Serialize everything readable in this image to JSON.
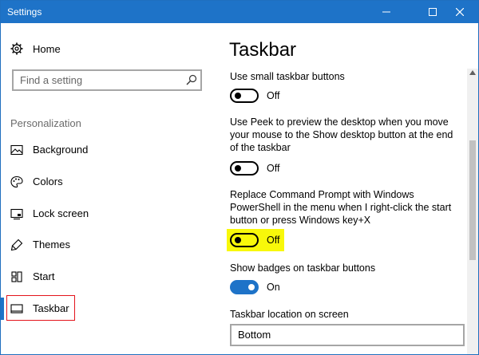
{
  "window": {
    "title": "Settings"
  },
  "sidebar": {
    "home_label": "Home",
    "search_placeholder": "Find a setting",
    "section_heading": "Personalization",
    "items": [
      {
        "label": "Background",
        "icon": "picture-icon"
      },
      {
        "label": "Colors",
        "icon": "palette-icon"
      },
      {
        "label": "Lock screen",
        "icon": "lock-screen-icon"
      },
      {
        "label": "Themes",
        "icon": "themes-icon"
      },
      {
        "label": "Start",
        "icon": "start-icon"
      },
      {
        "label": "Taskbar",
        "icon": "taskbar-icon",
        "selected": true
      }
    ]
  },
  "main": {
    "title": "Taskbar",
    "settings": [
      {
        "label": "Use small taskbar buttons",
        "state": "Off",
        "on": false
      },
      {
        "label": "Use Peek to preview the desktop when you move your mouse to the Show desktop button at the end of the taskbar",
        "state": "Off",
        "on": false
      },
      {
        "label": "Replace Command Prompt with Windows PowerShell in the menu when I right-click the start button or press Windows key+X",
        "state": "Off",
        "on": false,
        "highlighted": true
      },
      {
        "label": "Show badges on taskbar buttons",
        "state": "On",
        "on": true
      }
    ],
    "location": {
      "label": "Taskbar location on screen",
      "value": "Bottom"
    }
  },
  "colors": {
    "accent": "#1e73c8",
    "highlight": "#f8f80a",
    "selection_box": "#e3141b"
  }
}
